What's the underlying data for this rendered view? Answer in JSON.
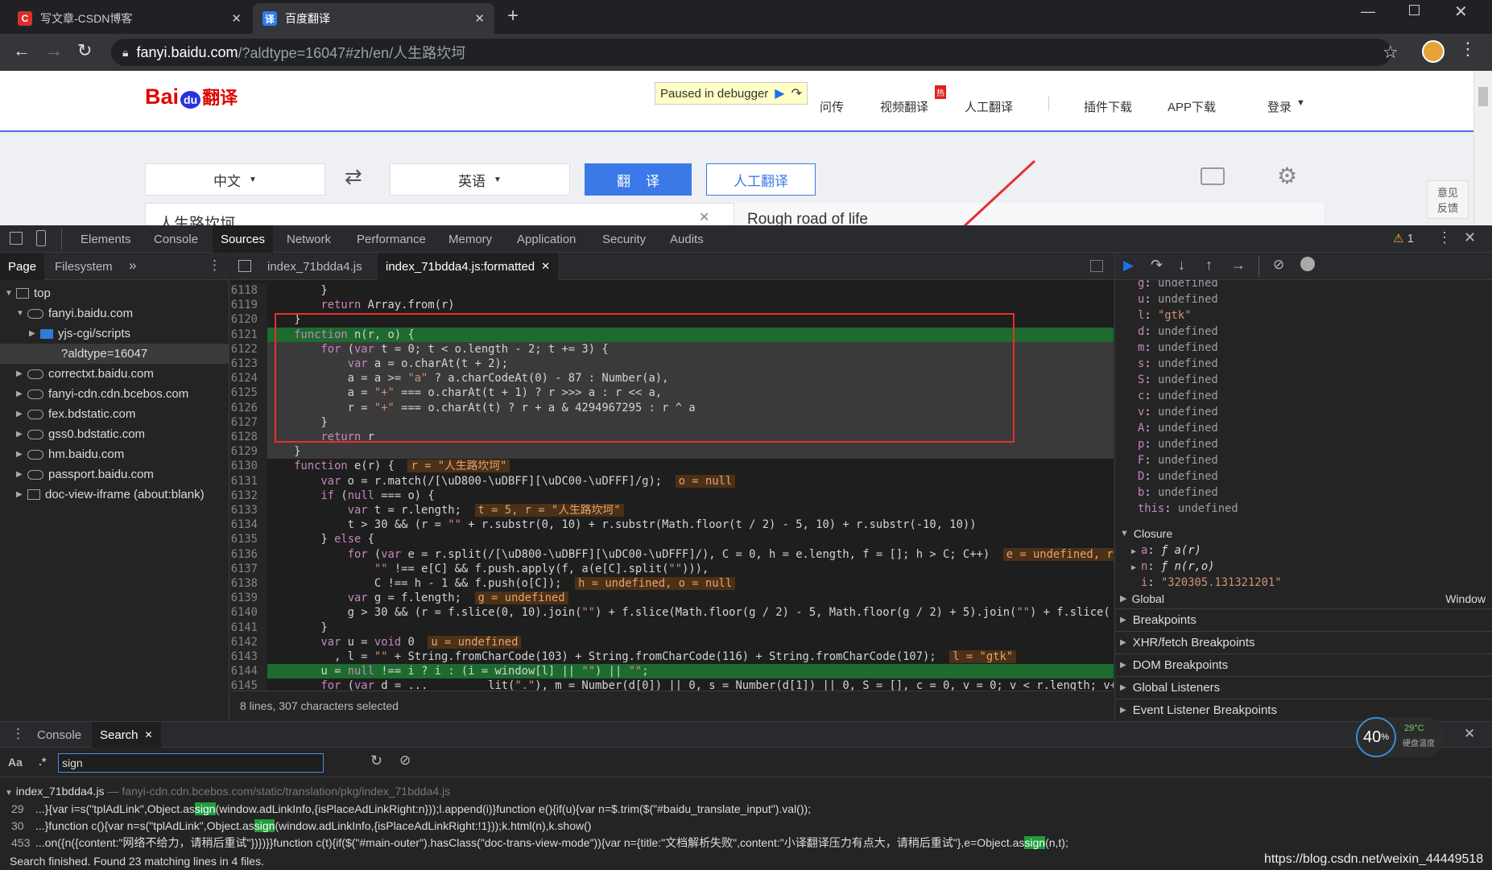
{
  "browser": {
    "tabs": [
      {
        "favicon": "C",
        "title": "写文章-CSDN博客",
        "active": false,
        "color": "#d9302b"
      },
      {
        "favicon": "译",
        "title": "百度翻译",
        "active": true,
        "color": "#2f7bf1"
      }
    ],
    "url_host": "fanyi.baidu.com",
    "url_path": "/?aldtype=16047#zh/en/人生路坎坷"
  },
  "page": {
    "logo_a": "Bai",
    "logo_b": "du",
    "logo_c": "翻译",
    "debugger_banner": "Paused in debugger",
    "nav": [
      "问传",
      "视频翻译",
      "人工翻译",
      "插件下载",
      "APP下载",
      "登录"
    ],
    "hot_badge": "热",
    "source_lang": "中文",
    "target_lang": "英语",
    "translate_btn": "翻    译",
    "human_btn": "人工翻译",
    "input_text": "人生路坎坷",
    "output_text": "Rough road of life",
    "feedback": "意见\n反馈"
  },
  "devtools": {
    "tabs": [
      "Elements",
      "Console",
      "Sources",
      "Network",
      "Performance",
      "Memory",
      "Application",
      "Security",
      "Audits"
    ],
    "warning_count": "1",
    "nav_tabs": [
      "Page",
      "Filesystem"
    ],
    "tree": [
      {
        "label": "top",
        "indent": 0,
        "type": "frame"
      },
      {
        "label": "fanyi.baidu.com",
        "indent": 1,
        "type": "cloud"
      },
      {
        "label": "yjs-cgi/scripts",
        "indent": 2,
        "type": "folder"
      },
      {
        "label": "?aldtype=16047",
        "indent": 3,
        "type": "file"
      },
      {
        "label": "correctxt.baidu.com",
        "indent": 1,
        "type": "cloud"
      },
      {
        "label": "fanyi-cdn.cdn.bcebos.com",
        "indent": 1,
        "type": "cloud"
      },
      {
        "label": "fex.bdstatic.com",
        "indent": 1,
        "type": "cloud"
      },
      {
        "label": "gss0.bdstatic.com",
        "indent": 1,
        "type": "cloud"
      },
      {
        "label": "hm.baidu.com",
        "indent": 1,
        "type": "cloud"
      },
      {
        "label": "passport.baidu.com",
        "indent": 1,
        "type": "cloud"
      },
      {
        "label": "doc-view-iframe (about:blank)",
        "indent": 1,
        "type": "frame"
      }
    ],
    "editor_tabs": [
      "index_71bdda4.js",
      "index_71bdda4.js:formatted"
    ],
    "code": [
      {
        "n": "6118",
        "t": "        }"
      },
      {
        "n": "6119",
        "t": "        return Array.from(r)"
      },
      {
        "n": "6120",
        "t": "    }"
      },
      {
        "n": "6121",
        "t": "    function n(r, o) {"
      },
      {
        "n": "6122",
        "t": "        for (var t = 0; t < o.length - 2; t += 3) {"
      },
      {
        "n": "6123",
        "t": "            var a = o.charAt(t + 2);"
      },
      {
        "n": "6124",
        "t": "            a = a >= \"a\" ? a.charCodeAt(0) - 87 : Number(a),"
      },
      {
        "n": "6125",
        "t": "            a = \"+\" === o.charAt(t + 1) ? r >>> a : r << a,"
      },
      {
        "n": "6126",
        "t": "            r = \"+\" === o.charAt(t) ? r + a & 4294967295 : r ^ a"
      },
      {
        "n": "6127",
        "t": "        }"
      },
      {
        "n": "6128",
        "t": "        return r"
      },
      {
        "n": "6129",
        "t": "    }"
      },
      {
        "n": "6130",
        "t": "    function e(r) {",
        "i": "r = \"人生路坎坷\""
      },
      {
        "n": "6131",
        "t": "        var o = r.match(/[\\uD800-\\uDBFF][\\uDC00-\\uDFFF]/g);",
        "i": "o = null"
      },
      {
        "n": "6132",
        "t": "        if (null === o) {"
      },
      {
        "n": "6133",
        "t": "            var t = r.length;",
        "i": "t = 5, r = \"人生路坎坷\""
      },
      {
        "n": "6134",
        "t": "            t > 30 && (r = \"\" + r.substr(0, 10) + r.substr(Math.floor(t / 2) - 5, 10) + r.substr(-10, 10))"
      },
      {
        "n": "6135",
        "t": "        } else {"
      },
      {
        "n": "6136",
        "t": "            for (var e = r.split(/[\\uD800-\\uDBFF][\\uDC00-\\uDFFF]/), C = 0, h = e.length, f = []; h > C; C++)",
        "i": "e = undefined, r"
      },
      {
        "n": "6137",
        "t": "                \"\" !== e[C] && f.push.apply(f, a(e[C].split(\"\"))),"
      },
      {
        "n": "6138",
        "t": "                C !== h - 1 && f.push(o[C]);",
        "i": "h = undefined, o = null"
      },
      {
        "n": "6139",
        "t": "            var g = f.length;",
        "i": "g = undefined"
      },
      {
        "n": "6140",
        "t": "            g > 30 && (r = f.slice(0, 10).join(\"\") + f.slice(Math.floor(g / 2) - 5, Math.floor(g / 2) + 5).join(\"\") + f.slice("
      },
      {
        "n": "6141",
        "t": "        }"
      },
      {
        "n": "6142",
        "t": "        var u = void 0",
        "i": "u = undefined"
      },
      {
        "n": "6143",
        "t": "          , l = \"\" + String.fromCharCode(103) + String.fromCharCode(116) + String.fromCharCode(107);",
        "i": "l = \"gtk\""
      },
      {
        "n": "6144",
        "t": "        u = null !== i ? i : (i = window[l] || \"\") || \"\";"
      },
      {
        "n": "6145",
        "t": "        for (var d = ...         lit(\".\"), m = Number(d[0]) || 0, s = Number(d[1]) || 0, S = [], c = 0, v = 0; v < r.length; v++) {"
      }
    ],
    "status": "8 lines, 307 characters selected",
    "scope_vars": [
      {
        "k": "g",
        "v": "undefined"
      },
      {
        "k": "u",
        "v": "undefined"
      },
      {
        "k": "l",
        "v": "\"gtk\"",
        "s": true
      },
      {
        "k": "d",
        "v": "undefined"
      },
      {
        "k": "m",
        "v": "undefined"
      },
      {
        "k": "s",
        "v": "undefined"
      },
      {
        "k": "S",
        "v": "undefined"
      },
      {
        "k": "c",
        "v": "undefined"
      },
      {
        "k": "v",
        "v": "undefined"
      },
      {
        "k": "A",
        "v": "undefined"
      },
      {
        "k": "p",
        "v": "undefined"
      },
      {
        "k": "F",
        "v": "undefined"
      },
      {
        "k": "D",
        "v": "undefined"
      },
      {
        "k": "b",
        "v": "undefined"
      },
      {
        "k": "this",
        "v": "undefined"
      }
    ],
    "closure_label": "Closure",
    "closure_vars": [
      {
        "k": "a",
        "v": "ƒ a(r)"
      },
      {
        "k": "n",
        "v": "ƒ n(r,o)"
      },
      {
        "k": "i",
        "v": "\"320305.131321201\"",
        "s": true
      }
    ],
    "global_label": "Global",
    "global_value": "Window",
    "sections": [
      "Breakpoints",
      "XHR/fetch Breakpoints",
      "DOM Breakpoints",
      "Global Listeners",
      "Event Listener Breakpoints"
    ],
    "drawer_tabs": [
      "Console",
      "Search"
    ],
    "search_query": "sign",
    "search_case": "Aa",
    "search_regex": ".*",
    "result_file": "index_71bdda4.js",
    "result_path": "— fanyi-cdn.cdn.bcebos.com/static/translation/pkg/index_71bdda4.js",
    "results": [
      {
        "n": "29",
        "a": "...}{var i=s(\"tplAdLink\",Object.as",
        "h": "sign",
        "b": "(window.adLinkInfo,{isPlaceAdLinkRight:n}));l.append(i)}function e(){if(u){var n=$.trim($(\"#baidu_translate_input\").val());"
      },
      {
        "n": "30",
        "a": "...}function c(){var n=s(\"tplAdLink\",Object.as",
        "h": "sign",
        "b": "(window.adLinkInfo,{isPlaceAdLinkRight:!1}));k.html(n),k.show()"
      },
      {
        "n": "453",
        "a": "...on({n({content:\"网络不给力，请稍后重试\"})})}}function c(t){if($(\"#main-outer\").hasClass(\"doc-trans-view-mode\")){var n={title:\"文档解析失败\",content:\"小译翻译压力有点大，请稍后重试\"},e=Object.as",
        "h": "sign",
        "b": "(n,t);"
      }
    ],
    "search_status": "Search finished.  Found 23 matching lines in 4 files.",
    "perf_pct": "40",
    "perf_unit": "%",
    "temp": "29°C",
    "temp_label": "硬盘温度",
    "watermark": "https://blog.csdn.net/weixin_44449518"
  }
}
